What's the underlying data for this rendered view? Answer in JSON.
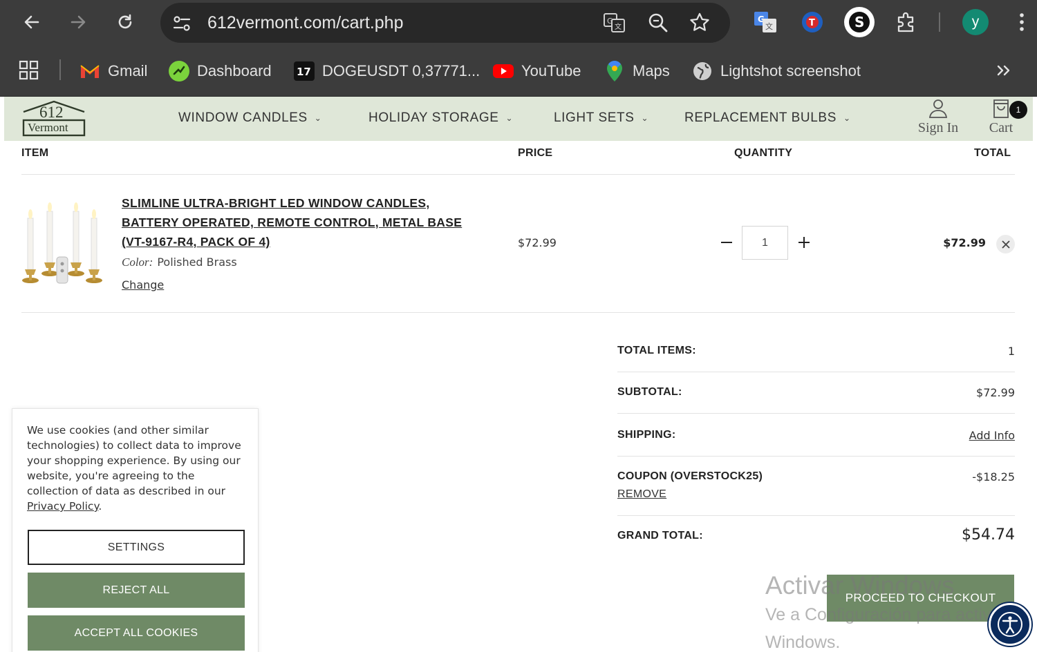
{
  "browser": {
    "url": "612vermont.com/cart.php",
    "profile_initial": "y",
    "bookmarks": [
      {
        "label": "Gmail",
        "icon": "gmail-icon"
      },
      {
        "label": "Dashboard",
        "icon": "dashboard-icon"
      },
      {
        "label": "DOGEUSDT 0,37771...",
        "icon": "tradingview-icon"
      },
      {
        "label": "YouTube",
        "icon": "youtube-icon"
      },
      {
        "label": "Maps",
        "icon": "maps-icon"
      },
      {
        "label": "Lightshot screenshot",
        "icon": "lightshot-icon"
      }
    ]
  },
  "site": {
    "logo_top": "612",
    "logo_bottom": "Vermont",
    "menu": [
      "WINDOW CANDLES",
      "HOLIDAY STORAGE",
      "LIGHT SETS",
      "REPLACEMENT BULBS"
    ],
    "sign_in": "Sign In",
    "cart": "Cart",
    "cart_count": "1"
  },
  "cart": {
    "headers": {
      "item": "ITEM",
      "price": "PRICE",
      "quantity": "QUANTITY",
      "total": "TOTAL"
    },
    "item": {
      "title_line1": "SLIMLINE ULTRA-BRIGHT LED WINDOW CANDLES,",
      "title_line2": "BATTERY OPERATED, REMOTE CONTROL, METAL BASE",
      "title_line3": "(VT-9167-R4, PACK OF 4)",
      "color_label": "Color:",
      "color_value": "Polished Brass",
      "change": "Change",
      "price": "$72.99",
      "quantity": "1",
      "total": "$72.99"
    }
  },
  "summary": {
    "total_items_label": "TOTAL ITEMS:",
    "total_items": "1",
    "subtotal_label": "SUBTOTAL:",
    "subtotal": "$72.99",
    "shipping_label": "SHIPPING:",
    "shipping_link": "Add Info",
    "coupon_label": "COUPON (OVERSTOCK25)",
    "coupon_remove": "REMOVE",
    "coupon_value": "-$18.25",
    "grand_total_label": "GRAND TOTAL:",
    "grand_total": "$54.74",
    "checkout": "PROCEED TO CHECKOUT"
  },
  "watermark": {
    "line1": "Activar Windows",
    "line2": "Ve a Configuración para activar",
    "line3": "Windows."
  },
  "cookie": {
    "text": "We use cookies (and other similar technologies) to collect data to improve your shopping experience. By using our website, you're agreeing to the collection of data as described in our ",
    "policy_link": "Privacy Policy",
    "settings": "SETTINGS",
    "reject": "REJECT ALL",
    "accept": "ACCEPT ALL COOKIES"
  },
  "colors": {
    "chrome_bg": "#3c3c3c",
    "omnibox_bg": "#282828",
    "header_bg": "#dfe7d8",
    "accent_green": "#6f8a66",
    "accessibility_blue": "#0a2a5c"
  }
}
